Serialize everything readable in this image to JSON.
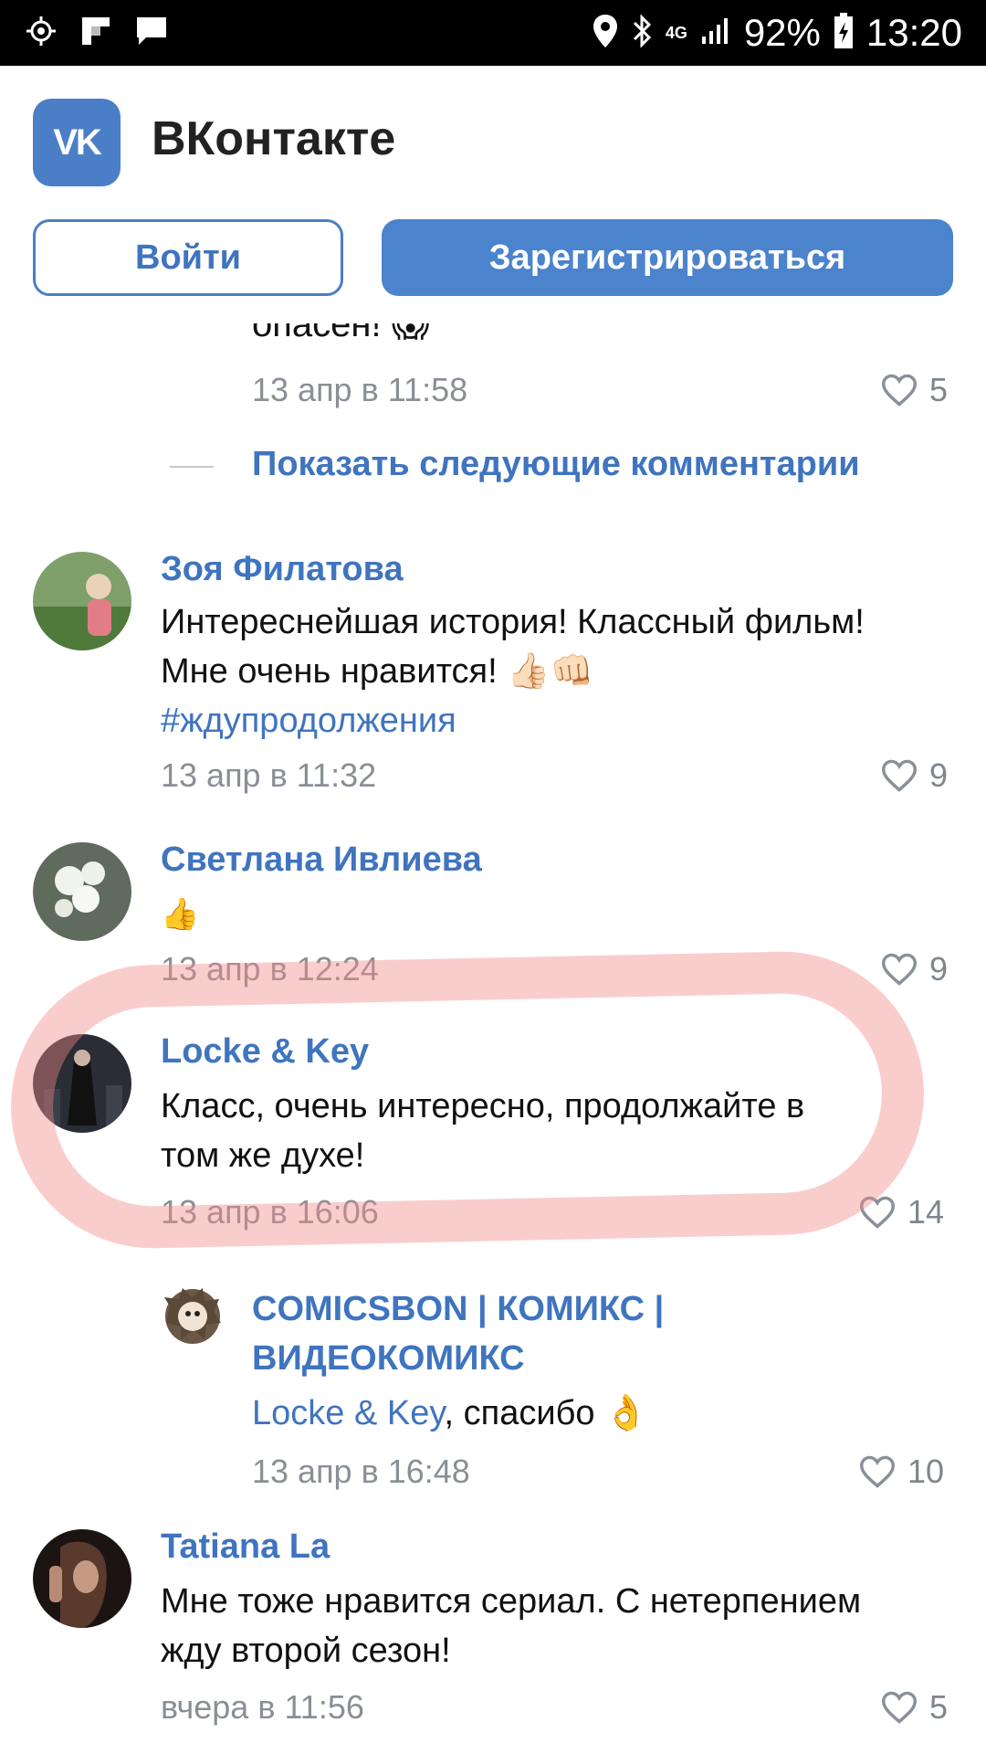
{
  "status_bar": {
    "battery": "92%",
    "time": "13:20",
    "network": "4G",
    "icons": [
      "target-icon",
      "flipboard-icon",
      "message-icon",
      "location-icon",
      "bluetooth-icon",
      "signal-icon",
      "battery-icon"
    ]
  },
  "app": {
    "title": "ВКонтакте",
    "logo_text": "VK",
    "login_label": "Войти",
    "register_label": "Зарегистрироваться",
    "accent": "#4a7fc7"
  },
  "feed": {
    "partial_comment": {
      "text": "опасен! 😱",
      "date": "13 апр в 11:58",
      "likes": "5"
    },
    "show_more_label": "Показать следующие комментарии",
    "comments": [
      {
        "name": "Зоя Филатова",
        "text_line1": "Интереснейшая история! Классный фильм!",
        "text_line2": "Мне очень нравится! 👍🏻👊🏻",
        "hashtag": "#ждупродолжения",
        "date": "13 апр в 11:32",
        "likes": "9"
      },
      {
        "name": "Светлана Ивлиева",
        "text": "👍",
        "date": "13 апр в 12:24",
        "likes": "9"
      },
      {
        "name": "Locke & Key",
        "text_line1": "Класс, очень интересно, продолжайте в",
        "text_line2": "том же духе!",
        "date": "13 апр в 16:06",
        "likes": "14"
      },
      {
        "name_line1": "COMICSBON | КОМИКС |",
        "name_line2": "ВИДЕОКОМИКС",
        "reply_to": "Locke & Key",
        "text": ", спасибо 👌",
        "date": "13 апр в 16:48",
        "likes": "10"
      },
      {
        "name": "Tatiana La",
        "text_line1": "Мне тоже нравится сериал. С нетерпением",
        "text_line2": "жду второй сезон!",
        "date": "вчера в 11:56",
        "likes": "5"
      }
    ]
  }
}
